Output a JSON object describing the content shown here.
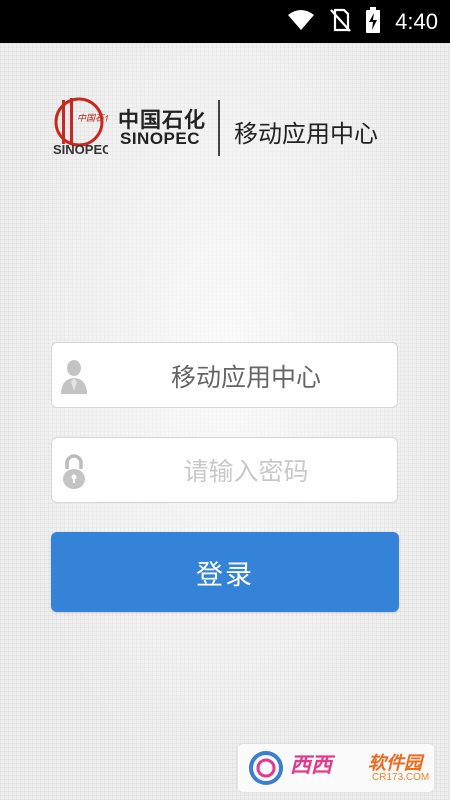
{
  "status_bar": {
    "time": "4:40",
    "icons": [
      "wifi-icon",
      "no-sim-icon",
      "battery-charging-icon"
    ]
  },
  "logo": {
    "emblem_text": "中国石化",
    "emblem_brand": "SINOPEC",
    "company_cn": "中国石化",
    "company_en": "SINOPEC",
    "app_center": "移动应用中心"
  },
  "form": {
    "username": {
      "value": "移动应用中心",
      "icon": "user-icon"
    },
    "password": {
      "placeholder": "请输入密码",
      "icon": "lock-icon"
    },
    "login_label": "登录"
  },
  "watermark": {
    "name": "西西",
    "suffix": "软件园",
    "domain": "CR173.COM"
  },
  "colors": {
    "accent": "#3483d8",
    "brand_red": "#c8281e",
    "status_bar": "#000000"
  }
}
